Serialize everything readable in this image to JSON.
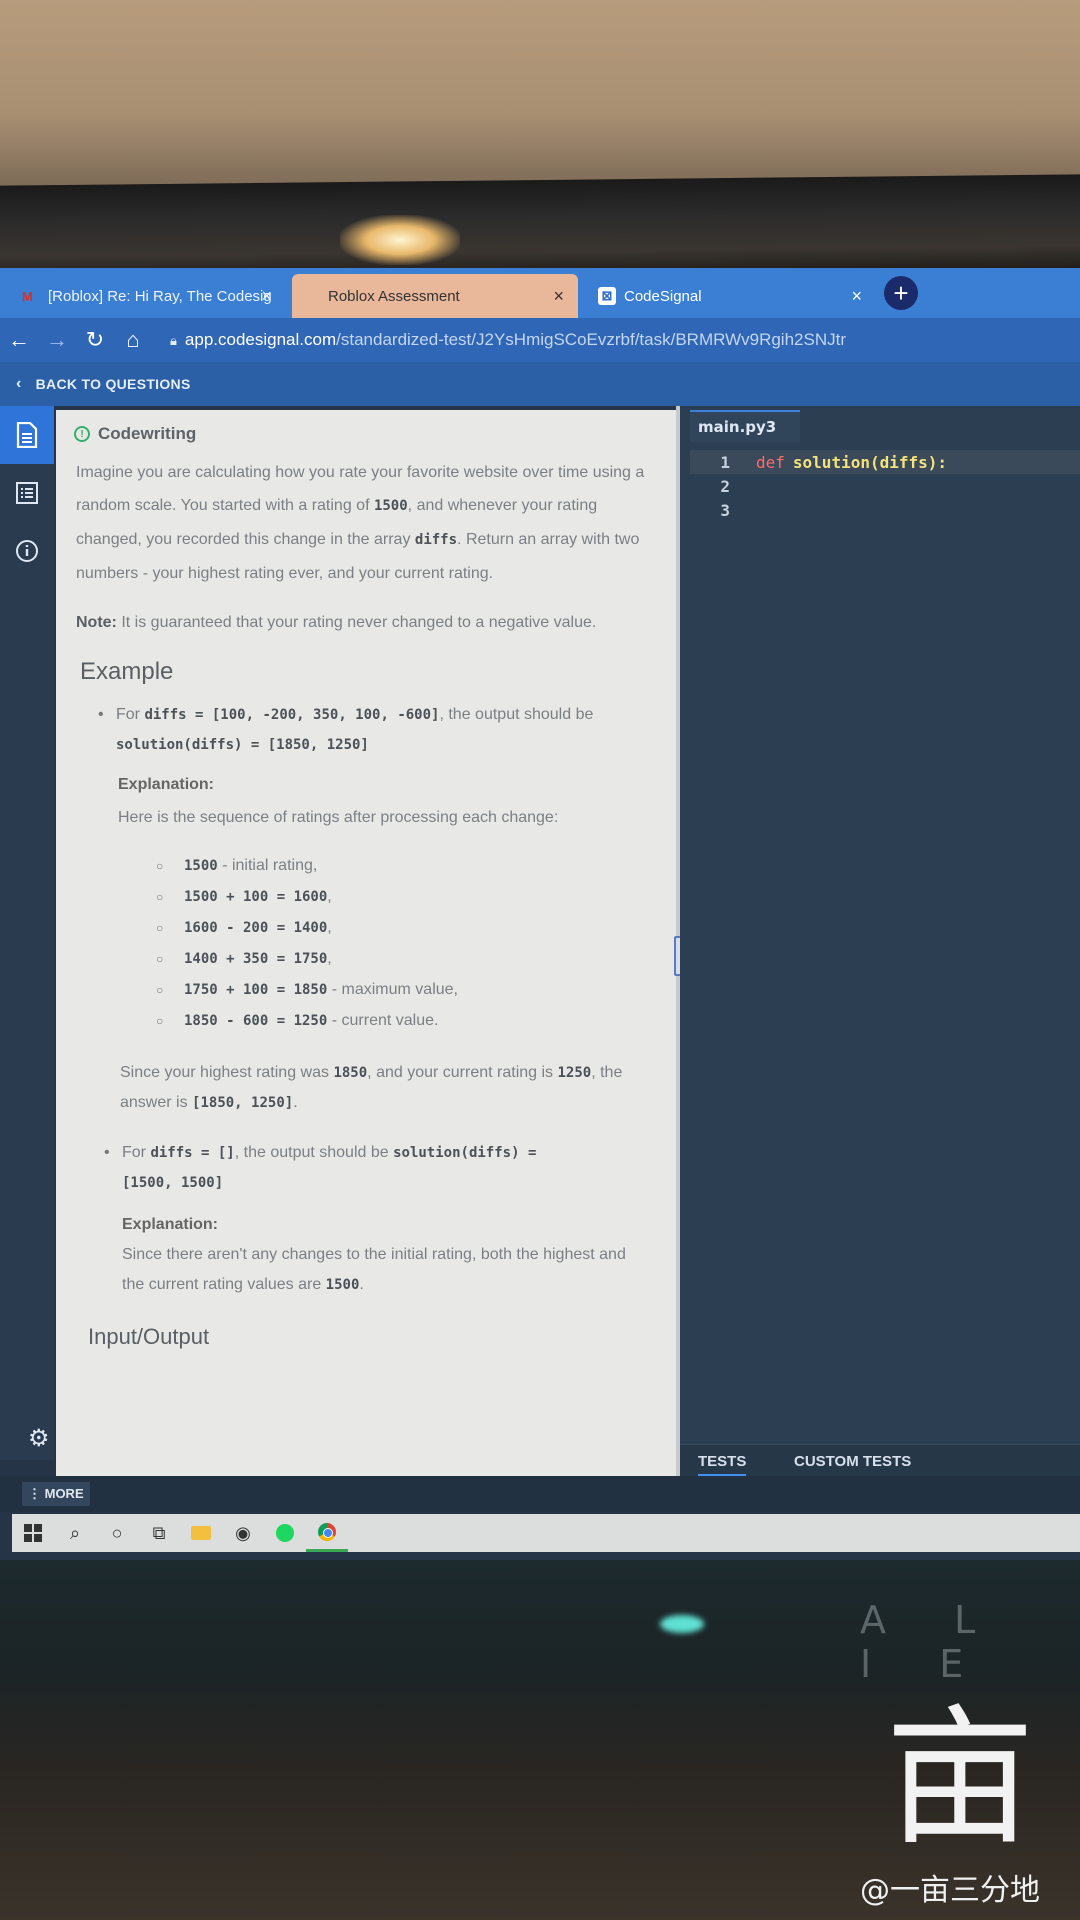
{
  "browser": {
    "tabs": [
      {
        "label": "[Roblox] Re: Hi Ray, The Codesig",
        "close": "×"
      },
      {
        "label": "Roblox Assessment",
        "close": "×"
      },
      {
        "label": "CodeSignal",
        "close": "×"
      }
    ],
    "new_tab": "+",
    "url_host": "app.codesignal.com",
    "url_path": "/standardized-test/J2YsHmigSCoEvzrbf/task/BRMRWv9Rgih2SNJtr"
  },
  "header": {
    "back_label": "BACK TO QUESTIONS"
  },
  "description": {
    "section_title": "Codewriting",
    "intro_1": "Imagine you are calculating how you rate your favorite website over time using a random scale. You started with a rating of ",
    "intro_code_1": "1500",
    "intro_2": ", and whenever your rating changed, you recorded this change in the array ",
    "intro_code_2": "diffs",
    "intro_3": ". Return an array with two numbers - your highest rating ever, and your current rating.",
    "note_label": "Note:",
    "note_text": " It is guaranteed that your rating never changed to a negative value.",
    "example_heading": "Example",
    "ex1_for": "For ",
    "ex1_input": "diffs = [100, -200, 350, 100, -600]",
    "ex1_mid": ", the output should be",
    "ex1_output": "solution(diffs) = [1850, 1250]",
    "ex1_expl_heading": "Explanation:",
    "ex1_expl_text": "Here is the sequence of ratings after processing each change:",
    "steps": [
      {
        "code": "1500",
        "note": " - initial rating,"
      },
      {
        "code": "1500 + 100 = 1600",
        "note": ","
      },
      {
        "code": "1600 - 200 = 1400",
        "note": ","
      },
      {
        "code": "1400 + 350 = 1750",
        "note": ","
      },
      {
        "code": "1750 + 100 = 1850",
        "note": " - maximum value,"
      },
      {
        "code": "1850 - 600 = 1250",
        "note": " - current value."
      }
    ],
    "ex1_summary_1": "Since your highest rating was ",
    "ex1_summary_code_1": "1850",
    "ex1_summary_2": ", and your current rating is ",
    "ex1_summary_code_2": "1250",
    "ex1_summary_3": ", the answer is ",
    "ex1_summary_code_3": "[1850, 1250]",
    "ex1_summary_4": ".",
    "ex2_for": "For ",
    "ex2_input": "diffs = []",
    "ex2_mid": ", the output should be ",
    "ex2_output_1": "solution(diffs) =",
    "ex2_output_2": "[1500, 1500]",
    "ex2_expl_heading": "Explanation:",
    "ex2_expl_text": "Since there aren't any changes to the initial rating, both the highest and the current rating values are ",
    "ex2_expl_code": "1500",
    "ex2_expl_end": ".",
    "io_heading": "Input/Output"
  },
  "editor": {
    "file_tab": "main.py3",
    "lines": [
      {
        "num": "1",
        "kw": "def",
        "code": "solution(diffs):"
      },
      {
        "num": "2",
        "kw": "",
        "code": ""
      },
      {
        "num": "3",
        "kw": "",
        "code": ""
      }
    ],
    "tests_tab": "TESTS",
    "custom_tests_tab": "CUSTOM TESTS"
  },
  "footer": {
    "more_label": "⋮ MORE"
  },
  "taskbar": {
    "icons": [
      "windows-start-icon",
      "search-icon",
      "cortana-icon",
      "task-view-icon",
      "file-explorer-icon",
      "alienware-icon",
      "spotify-icon",
      "chrome-icon"
    ]
  },
  "photo": {
    "brand_text": "A L I E",
    "watermark": "@一亩三分地",
    "watermark_glyph": "亩"
  },
  "colors": {
    "tab_bar": "#3a7fd4",
    "address_bar": "#2f66b6",
    "editor_bg": "#2c3e52",
    "keyword": "#ff6b6b",
    "function": "#f6e27a",
    "accent_green": "#33b06a"
  }
}
